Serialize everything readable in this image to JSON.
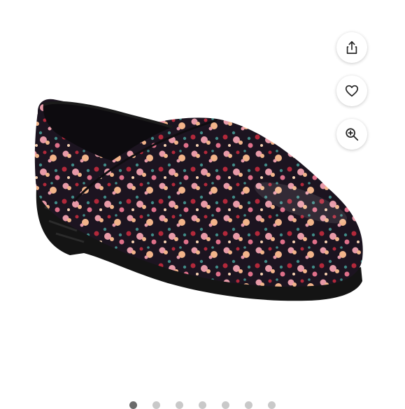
{
  "product": {
    "image_subject": "floral-patterned-clog",
    "colors": {
      "upper_base": "#1c1420",
      "sole": "#141414",
      "flower_pink": "#e89aa8",
      "flower_peach": "#f2b48a",
      "flower_red": "#b3283a",
      "leaf_teal": "#3f8a86"
    }
  },
  "actions": {
    "share_icon": "share-icon",
    "like_icon": "heart-icon",
    "zoom_icon": "zoom-in-icon"
  },
  "carousel": {
    "total": 7,
    "active_index": 0
  }
}
